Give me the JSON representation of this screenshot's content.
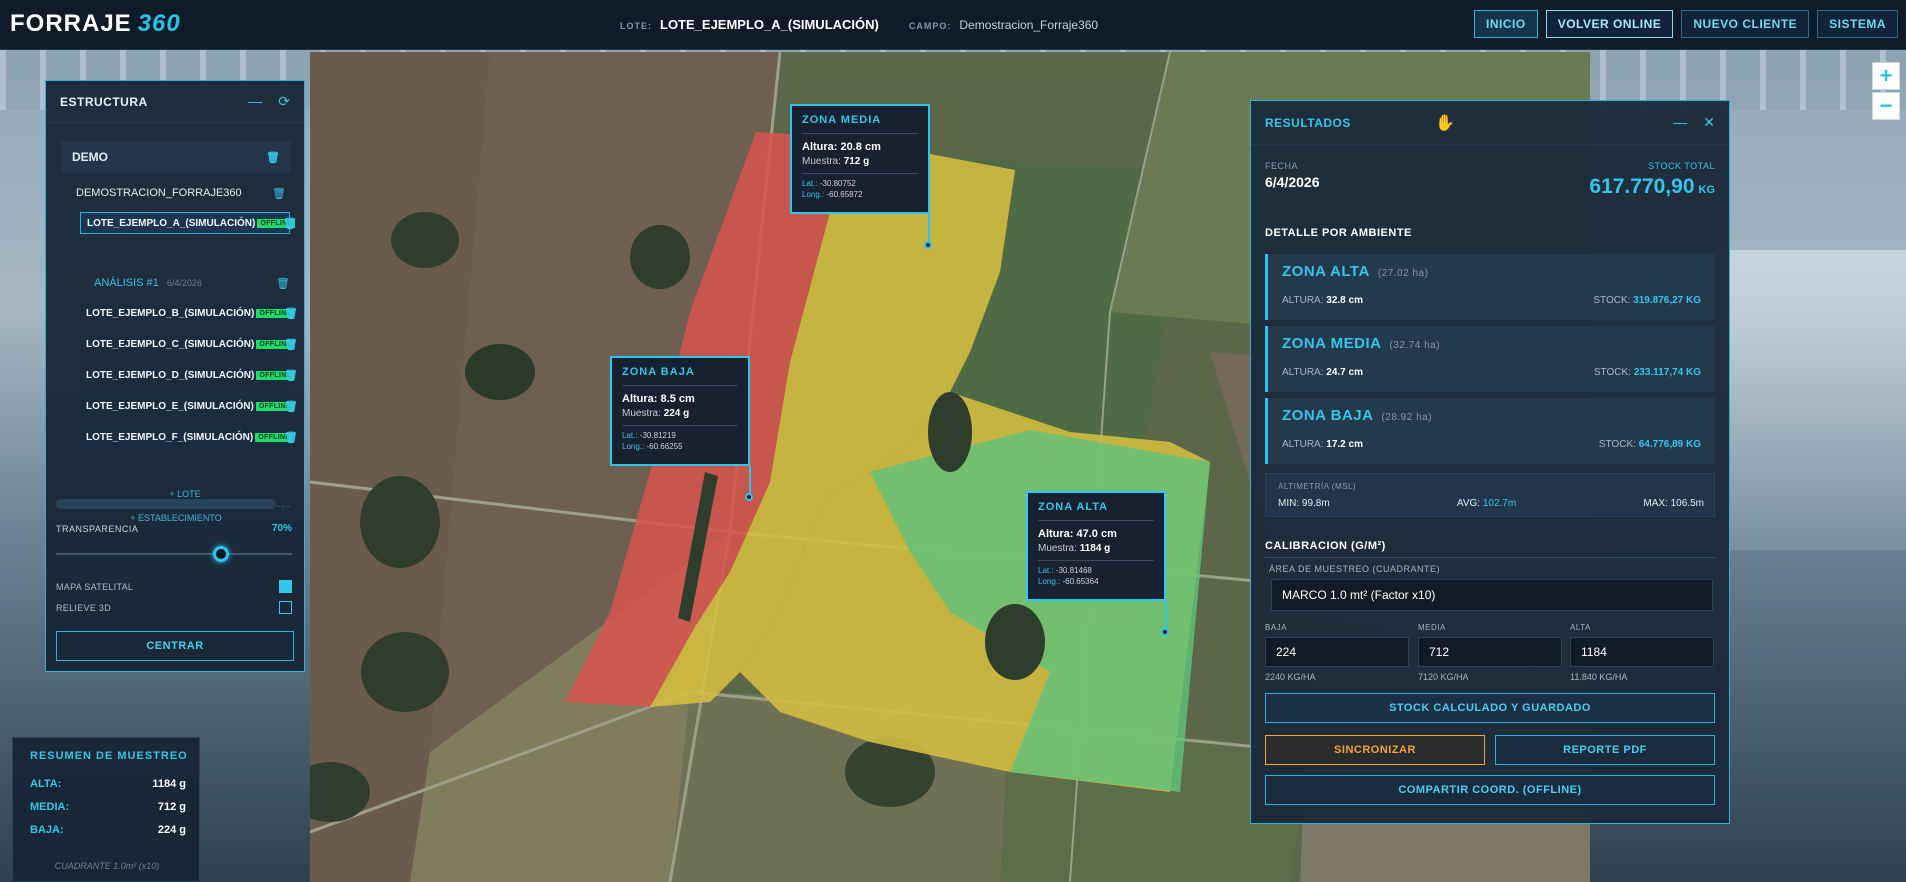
{
  "brand": {
    "name": "FORRAJE",
    "suffix": "360"
  },
  "header": {
    "lote_label": "LOTE:",
    "lote_value": "LOTE_EJEMPLO_A_(SIMULACIÓN)",
    "campo_label": "CAMPO:",
    "campo_value": "Demostracion_Forraje360"
  },
  "nav": {
    "inicio": "INICIO",
    "volver_online": "VOLVER ONLINE",
    "nuevo_cliente": "NUEVO CLIENTE",
    "sistema": "SISTEMA"
  },
  "zoom": {
    "in": "+",
    "out": "−"
  },
  "estructura": {
    "title": "ESTRUCTURA",
    "cliente": "DEMO",
    "establecimiento": "DEMOSTRACION_FORRAJE360",
    "offline_badge": "OFFLINE",
    "lotes": [
      "LOTE_EJEMPLO_A_(SIMULACIÓN)",
      "LOTE_EJEMPLO_B_(SIMULACIÓN)",
      "LOTE_EJEMPLO_C_(SIMULACIÓN)",
      "LOTE_EJEMPLO_D_(SIMULACIÓN)",
      "LOTE_EJEMPLO_E_(SIMULACIÓN)",
      "LOTE_EJEMPLO_F_(SIMULACIÓN)"
    ],
    "analisis_label": "ANÁLISIS #1",
    "analisis_date": "6/4/2026",
    "add_lote": "+ LOTE",
    "add_establecimiento": "+ ESTABLECIMIENTO",
    "transparencia_label": "TRANSPARENCIA",
    "transparencia_value": "70%",
    "transparencia_fraction": 0.7,
    "mapa_satelital_label": "MAPA SATELITAL",
    "mapa_satelital_checked": true,
    "relieve_label": "RELIEVE 3D",
    "relieve_checked": false,
    "centrar": "CENTRAR"
  },
  "resumen": {
    "title": "RESUMEN DE MUESTREO",
    "rows": [
      {
        "k": "ALTA:",
        "v": "1184 g"
      },
      {
        "k": "MEDIA:",
        "v": "712 g"
      },
      {
        "k": "BAJA:",
        "v": "224 g"
      }
    ],
    "footer": "CUADRANTE 1.0m² (x10)"
  },
  "callouts": {
    "media": {
      "title": "ZONA MEDIA",
      "altura_l": "Altura:",
      "altura_v": "20.8 cm",
      "muestra_l": "Muestra:",
      "muestra_v": "712 g",
      "lat_l": "Lat.:",
      "lat_v": "-30.80752",
      "lng_l": "Long.:",
      "lng_v": "-60.65872"
    },
    "baja": {
      "title": "ZONA BAJA",
      "altura_l": "Altura:",
      "altura_v": "8.5 cm",
      "muestra_l": "Muestra:",
      "muestra_v": "224 g",
      "lat_l": "Lat.:",
      "lat_v": "-30.81219",
      "lng_l": "Long.:",
      "lng_v": "-60.66255"
    },
    "alta": {
      "title": "ZONA ALTA",
      "altura_l": "Altura:",
      "altura_v": "47.0 cm",
      "muestra_l": "Muestra:",
      "muestra_v": "1184 g",
      "lat_l": "Lat.:",
      "lat_v": "-30.81468",
      "lng_l": "Long.:",
      "lng_v": "-60.65364"
    }
  },
  "resultados": {
    "title": "RESULTADOS",
    "fecha_label": "FECHA",
    "fecha_value": "6/4/2026",
    "stock_total_label": "STOCK TOTAL",
    "stock_total_value": "617.770,90",
    "stock_total_unit": "KG",
    "detalle_title": "DETALLE POR AMBIENTE",
    "zonas": [
      {
        "name": "ZONA ALTA",
        "ha": "(27.02 ha)",
        "altura_l": "ALTURA:",
        "altura_v": "32.8 cm",
        "stock_l": "STOCK:",
        "stock_v": "319.876,27 KG"
      },
      {
        "name": "ZONA MEDIA",
        "ha": "(32.74 ha)",
        "altura_l": "ALTURA:",
        "altura_v": "24.7 cm",
        "stock_l": "STOCK:",
        "stock_v": "233.117,74 KG"
      },
      {
        "name": "ZONA BAJA",
        "ha": "(28.92 ha)",
        "altura_l": "ALTURA:",
        "altura_v": "17.2 cm",
        "stock_l": "STOCK:",
        "stock_v": "64.776,89 KG"
      }
    ],
    "altimetria": {
      "title": "ALTIMETRÍA (MSL)",
      "min_l": "MIN:",
      "min_v": "99.8m",
      "avg_l": "AVG:",
      "avg_v": "102.7m",
      "max_l": "MAX:",
      "max_v": "106.5m"
    },
    "calibracion_title": "CALIBRACION (G/M²)",
    "area_label": "ÁREA DE MUESTREO (CUADRANTE)",
    "area_value": "MARCO 1.0 mt² (Factor x10)",
    "cal": [
      {
        "label": "BAJA",
        "value": "224",
        "sub": "2240 KG/HA"
      },
      {
        "label": "MEDIA",
        "value": "712",
        "sub": "7120 KG/HA"
      },
      {
        "label": "ALTA",
        "value": "1184",
        "sub": "11.840 KG/HA"
      }
    ],
    "btn_stock": "STOCK CALCULADO Y GUARDADO",
    "btn_sync": "SINCRONIZAR",
    "btn_pdf": "REPORTE PDF",
    "btn_share": "COMPARTIR COORD. (OFFLINE)"
  },
  "colors": {
    "accent": "#2bc6ef",
    "zone_alta": "#5fc27a",
    "zone_media": "#d6be3f",
    "zone_baja": "#d9534f",
    "offline": "#1fdc6a",
    "sync": "#f0a63a"
  },
  "icons": [
    "trash-icon",
    "minimize-icon",
    "refresh-icon",
    "close-icon",
    "hand-cursor-icon"
  ]
}
